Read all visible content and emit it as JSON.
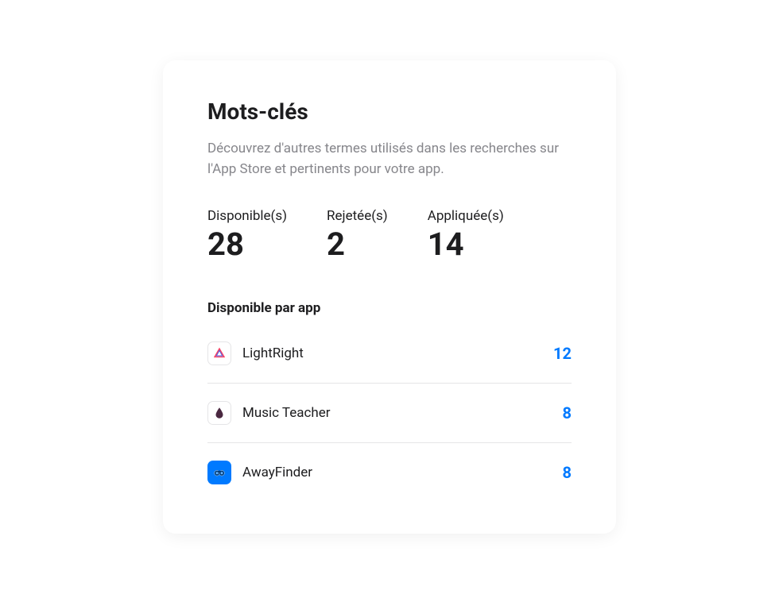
{
  "card": {
    "title": "Mots-clés",
    "description": "Découvrez d'autres termes utilisés dans les recherches sur l'App Store et pertinents pour votre app."
  },
  "stats": {
    "available": {
      "label": "Disponible(s)",
      "value": "28"
    },
    "rejected": {
      "label": "Rejetée(s)",
      "value": "2"
    },
    "applied": {
      "label": "Appliquée(s)",
      "value": "14"
    }
  },
  "section": {
    "title": "Disponible par app"
  },
  "apps": [
    {
      "name": "LightRight",
      "count": "12"
    },
    {
      "name": "Music Teacher",
      "count": "8"
    },
    {
      "name": "AwayFinder",
      "count": "8"
    }
  ]
}
